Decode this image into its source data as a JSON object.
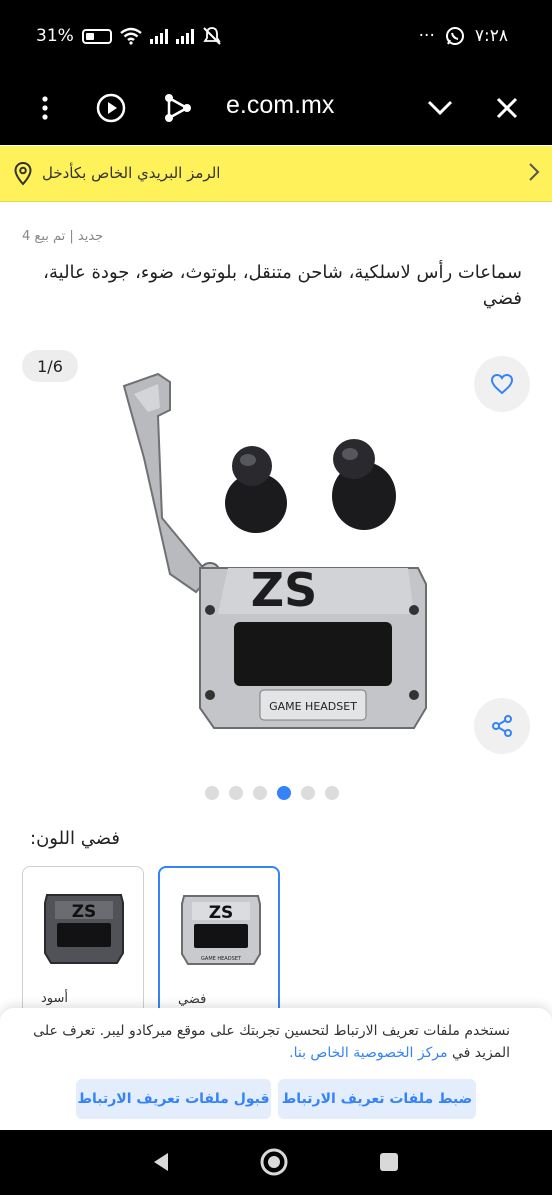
{
  "status_bar": {
    "battery_percent": "31%",
    "time": "٧:٢٨",
    "more": "···"
  },
  "browser": {
    "url": "e.com.mx",
    "icons": [
      "more-vert-icon",
      "play-icon",
      "share-nodes-icon",
      "chevron-down-icon",
      "close-icon"
    ]
  },
  "zip_bar": {
    "text": "الرمز البريدي الخاص بكأدخل"
  },
  "product": {
    "meta": "جديد | تم بيع 4",
    "title": "سماعات رأس لاسلكية، شاحن متنقل، بلوتوث، ضوء، جودة عالية، فضي",
    "image_counter": "1/6",
    "image_label": "GAME HEADSET",
    "image_logo": "ZS",
    "dots": {
      "total": 6,
      "active_index": 3
    }
  },
  "color": {
    "label": "فضي اللون:",
    "options": [
      {
        "label": "أسود",
        "selected": false
      },
      {
        "label": "فضي",
        "selected": true
      }
    ]
  },
  "cookie": {
    "message": "نستخدم ملفات تعريف الارتباط لتحسين تجربتك على موقع ميركادو ليبر. تعرف على المزيد في",
    "link": "مركز الخصوصية الخاص بنا.",
    "settings_button": "ضبط ملفات تعريف الارتباط",
    "accept_button": "قبول ملفات تعريف الارتباط"
  },
  "colors": {
    "accent": "#3483fa",
    "zip_bar": "#fff159"
  }
}
